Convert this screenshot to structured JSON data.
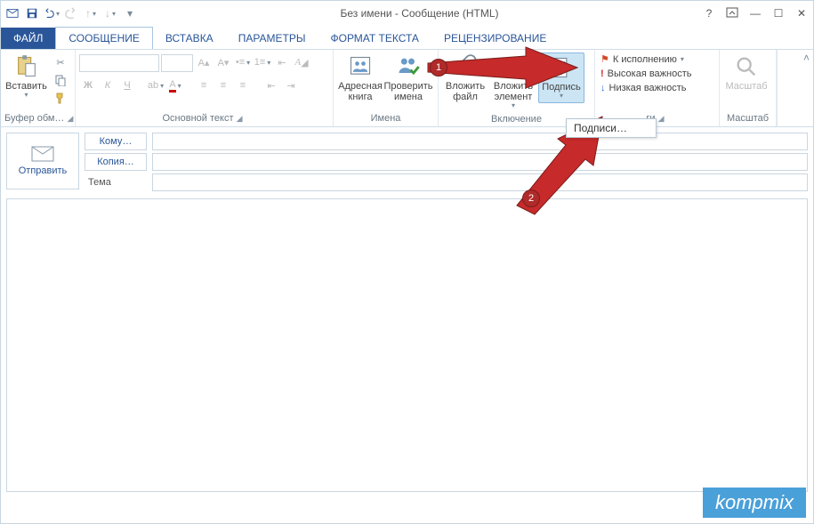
{
  "window": {
    "title": "Без имени - Сообщение (HTML)"
  },
  "tabs": {
    "file": "ФАЙЛ",
    "message": "СООБЩЕНИЕ",
    "insert": "ВСТАВКА",
    "options": "ПАРАМЕТРЫ",
    "format": "ФОРМАТ ТЕКСТА",
    "review": "РЕЦЕНЗИРОВАНИЕ"
  },
  "ribbon": {
    "clipboard": {
      "paste": "Вставить",
      "label": "Буфер обм…"
    },
    "font": {
      "bold": "Ж",
      "italic": "К",
      "underline": "Ч",
      "label": "Основной текст"
    },
    "names": {
      "address_book": "Адресная книга",
      "check_names": "Проверить имена",
      "label": "Имена"
    },
    "include": {
      "attach_file": "Вложить файл",
      "attach_item": "Вложить элемент",
      "signature": "Подпись",
      "label": "Включение"
    },
    "tags": {
      "followup": "К исполнению",
      "high": "Высокая важность",
      "low": "Низкая важность",
      "label": "ги"
    },
    "zoom": {
      "button": "Масштаб",
      "label": "Масштаб"
    }
  },
  "menu": {
    "signatures": "Подписи…"
  },
  "compose": {
    "send": "Отправить",
    "to": "Кому…",
    "cc": "Копия…",
    "subject": "Тема"
  },
  "markers": {
    "m1": "1",
    "m2": "2"
  },
  "watermark": "kompmix"
}
